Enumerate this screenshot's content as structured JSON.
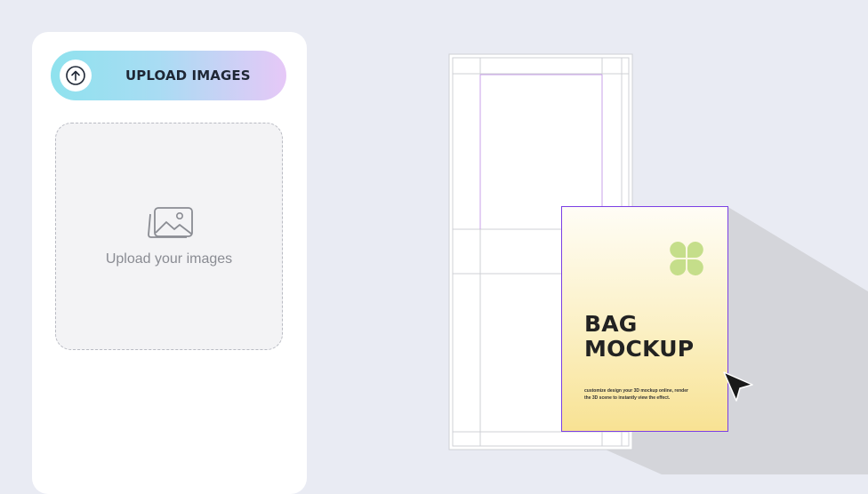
{
  "sidebar": {
    "upload_button_label": "UPLOAD IMAGES",
    "upload_icon": "arrow-up-circle-icon",
    "dropzone_icon": "images-icon",
    "dropzone_text": "Upload your images"
  },
  "canvas": {
    "card": {
      "title_line1": "BAG",
      "title_line2": "MOCKUP",
      "description": "customize design your 3D mockup online, render the 3D scene to instantly view the effect.",
      "logo_icon": "four-leaf-logo-icon"
    },
    "cursor_icon": "pointer-arrow-icon"
  },
  "colors": {
    "background": "#e9ebf3",
    "selection": "#7b3fe4",
    "guide_lines": "#c9a0e8",
    "logo": "#c5de8a",
    "shadow": "#d4d5da"
  }
}
